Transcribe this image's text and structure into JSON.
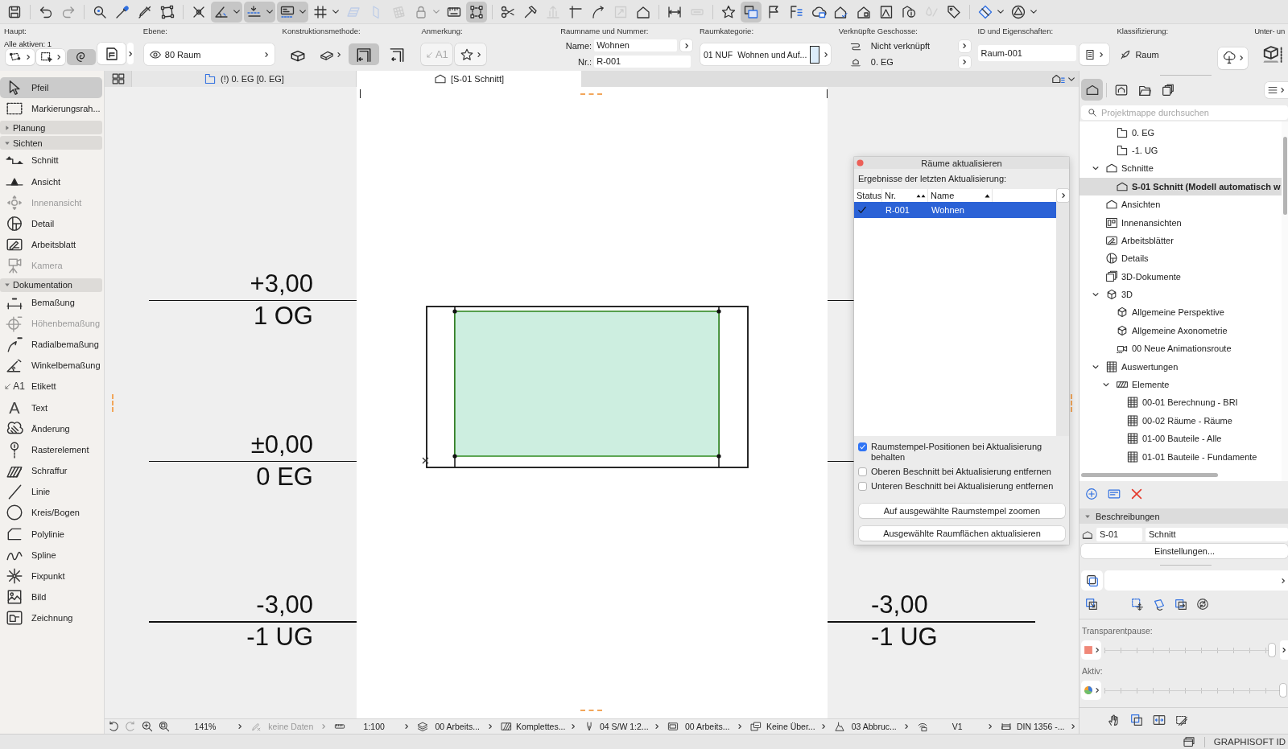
{
  "toolbar": {
    "groups": [
      [
        {
          "on": false,
          "disabled": false,
          "menu": false
        }
      ],
      [
        {
          "on": false,
          "disabled": false,
          "menu": false
        },
        {
          "on": false,
          "disabled": true,
          "menu": false
        }
      ],
      [
        {
          "on": false,
          "disabled": false,
          "menu": false
        },
        {
          "on": false,
          "disabled": false,
          "menu": false
        },
        {
          "on": false,
          "disabled": false,
          "menu": false
        },
        {
          "on": false,
          "disabled": false,
          "menu": false
        }
      ],
      [
        {
          "on": false,
          "disabled": false,
          "menu": false
        },
        {
          "on": true,
          "disabled": false,
          "menu": true
        },
        {
          "on": true,
          "disabled": false,
          "menu": true
        },
        {
          "on": true,
          "disabled": false,
          "menu": true
        },
        {
          "on": false,
          "disabled": false,
          "menu": true
        },
        {
          "on": false,
          "disabled": true,
          "menu": false
        },
        {
          "on": false,
          "disabled": true,
          "menu": false
        },
        {
          "on": false,
          "disabled": true,
          "menu": false
        },
        {
          "on": false,
          "disabled": true,
          "menu": true
        },
        {
          "on": false,
          "disabled": false,
          "menu": false
        },
        {
          "on": true,
          "disabled": false,
          "menu": false
        }
      ],
      [
        {
          "on": false,
          "disabled": false,
          "menu": false
        },
        {
          "on": false,
          "disabled": false,
          "menu": false
        },
        {
          "on": false,
          "disabled": true,
          "menu": false
        },
        {
          "on": false,
          "disabled": false,
          "menu": false
        },
        {
          "on": false,
          "disabled": false,
          "menu": false
        },
        {
          "on": false,
          "disabled": true,
          "menu": false
        },
        {
          "on": false,
          "disabled": false,
          "menu": false
        }
      ],
      [
        {
          "on": false,
          "disabled": false,
          "menu": false
        },
        {
          "on": false,
          "disabled": true,
          "menu": false
        }
      ],
      [
        {
          "on": false,
          "disabled": false,
          "menu": false
        },
        {
          "on": true,
          "disabled": false,
          "menu": false
        },
        {
          "on": false,
          "disabled": false,
          "menu": false
        },
        {
          "on": false,
          "disabled": false,
          "menu": false
        },
        {
          "on": false,
          "disabled": false,
          "menu": false
        },
        {
          "on": false,
          "disabled": false,
          "menu": false
        },
        {
          "on": false,
          "disabled": false,
          "menu": false
        },
        {
          "on": false,
          "disabled": false,
          "menu": false
        },
        {
          "on": false,
          "disabled": false,
          "menu": false
        },
        {
          "on": false,
          "disabled": true,
          "menu": false
        },
        {
          "on": false,
          "disabled": false,
          "menu": false
        }
      ],
      [
        {
          "on": false,
          "disabled": false,
          "menu": true
        },
        {
          "on": false,
          "disabled": false,
          "menu": true
        }
      ]
    ]
  },
  "info_box": {
    "main": {
      "title": "Haupt:",
      "status": "Alle aktiven: 1",
      "tools": [
        {
          "on": false,
          "menu": true
        },
        {
          "on": false,
          "menu": true
        },
        {
          "on": true,
          "menu": false
        }
      ]
    },
    "layer": {
      "title": "Ebene:",
      "value": "80 Raum"
    },
    "construction": {
      "title": "Konstruktionsmethode:",
      "methods": [
        {
          "selected": false,
          "menu": false
        },
        {
          "selected": false,
          "menu": true
        },
        {
          "selected": true,
          "menu": false
        },
        {
          "selected": false,
          "menu": false
        }
      ]
    },
    "annotation": {
      "title": "Anmerkung:",
      "tools": [
        {
          "label": "A1",
          "disabled": true,
          "menu": false
        },
        {
          "disabled": false,
          "menu": true
        }
      ]
    },
    "room_name": {
      "title": "Raumname und Nummer:",
      "fields": [
        {
          "label": "Name:",
          "value": "Wohnen"
        },
        {
          "label": "Nr.:",
          "value": "R-001"
        }
      ]
    },
    "category": {
      "title": "Raumkategorie:",
      "code": "01 NUF",
      "name": "Wohnen und Auf..."
    },
    "linked_stories": {
      "title": "Verknüpfte Geschosse:",
      "rows": [
        "Nicht verknüpft",
        "0. EG"
      ]
    },
    "properties": {
      "title": "ID und Eigenschaften:",
      "value": "Raum-001"
    },
    "classification": {
      "title": "Klassifizierung:",
      "value": "Raum"
    },
    "subelements": {
      "title": "Unter- un"
    }
  },
  "toolbox": {
    "tools": [
      {
        "label": "Pfeil",
        "selected": true,
        "disabled": false
      },
      {
        "label": "Markierungsrah...",
        "selected": false,
        "disabled": false
      }
    ],
    "groups": [
      {
        "label": "Planung",
        "expanded": false
      },
      {
        "label": "Sichten",
        "expanded": true,
        "tools": [
          {
            "label": "Schnitt",
            "selected": false,
            "disabled": false
          },
          {
            "label": "Ansicht",
            "selected": false,
            "disabled": false
          },
          {
            "label": "Innenansicht",
            "selected": false,
            "disabled": true
          },
          {
            "label": "Detail",
            "selected": false,
            "disabled": false
          },
          {
            "label": "Arbeitsblatt",
            "selected": false,
            "disabled": false
          },
          {
            "label": "Kamera",
            "selected": false,
            "disabled": true
          }
        ]
      },
      {
        "label": "Dokumentation",
        "expanded": true,
        "tools": [
          {
            "label": "Bemaßung",
            "selected": false,
            "disabled": false
          },
          {
            "label": "Höhenbemaßung",
            "selected": false,
            "disabled": true
          },
          {
            "label": "Radialbemaßung",
            "selected": false,
            "disabled": false
          },
          {
            "label": "Winkelbemaßung",
            "selected": false,
            "disabled": false
          },
          {
            "label": "Etikett",
            "glyph": "A1",
            "selected": false,
            "disabled": false
          },
          {
            "label": "Text",
            "glyph": "A",
            "selected": false,
            "disabled": false
          },
          {
            "label": "Änderung",
            "selected": false,
            "disabled": false
          },
          {
            "label": "Rasterelement",
            "selected": false,
            "disabled": false
          },
          {
            "label": "Schraffur",
            "selected": false,
            "disabled": false
          },
          {
            "label": "Linie",
            "selected": false,
            "disabled": false
          },
          {
            "label": "Kreis/Bogen",
            "selected": false,
            "disabled": false
          },
          {
            "label": "Polylinie",
            "selected": false,
            "disabled": false
          },
          {
            "label": "Spline",
            "selected": false,
            "disabled": false
          },
          {
            "label": "Fixpunkt",
            "selected": false,
            "disabled": false
          },
          {
            "label": "Bild",
            "selected": false,
            "disabled": false
          },
          {
            "label": "Zeichnung",
            "selected": false,
            "disabled": false
          }
        ]
      }
    ]
  },
  "view_tabs": [
    {
      "label": "(!) 0. EG [0. EG]",
      "kind": "plan",
      "selected": false
    },
    {
      "label": "[S-01 Schnitt]",
      "kind": "section",
      "selected": true
    }
  ],
  "canvas": {
    "levels": [
      {
        "left": {
          "elevation": "+3,00",
          "name": "1 OG"
        }
      },
      {
        "left": {
          "elevation": "±0,00",
          "name": "0 EG"
        }
      },
      {
        "left": {
          "elevation": "-3,00",
          "name": "-1 UG"
        },
        "right": {
          "elevation": "-3,00",
          "name": "-1 UG"
        }
      }
    ]
  },
  "update_dialog": {
    "title": "Räume aktualisieren",
    "subtitle": "Ergebnisse der letzten Aktualisierung:",
    "columns": [
      {
        "label": "Status",
        "kind": "plain"
      },
      {
        "label": "Nr.",
        "kind": "multisort"
      },
      {
        "label": "Name",
        "kind": "sorted"
      }
    ],
    "rows": [
      {
        "updated": true,
        "number": "R-001",
        "name": "Wohnen",
        "selected": true
      }
    ],
    "options": [
      {
        "label": "Raumstempel-Positionen bei Aktualisierung behalten",
        "checked": true
      },
      {
        "label": "Oberen Beschnitt bei Aktualisierung entfernen",
        "checked": false
      },
      {
        "label": "Unteren Beschnitt bei Aktualisierung entfernen",
        "checked": false
      }
    ],
    "buttons": [
      "Auf ausgewählte Raumstempel zoomen",
      "Ausgewählte Raumflächen aktualisieren"
    ]
  },
  "navigator": {
    "views": [
      {
        "selected": true
      },
      {
        "selected": false
      },
      {
        "selected": false
      },
      {
        "selected": false
      }
    ],
    "search": {
      "placeholder": "Projektmappe durchsuchen"
    },
    "tree": {
      "hidden_parent_children": [
        {
          "label": "0. EG",
          "kind": "story",
          "selected": false
        },
        {
          "label": "-1. UG",
          "kind": "story",
          "selected": false
        }
      ],
      "items": [
        {
          "label": "Schnitte",
          "kind": "section",
          "selected": false,
          "expanded": true,
          "children": [
            {
              "label": "S-01 Schnitt (Modell automatisch w",
              "kind": "section",
              "selected": true
            }
          ]
        },
        {
          "label": "Ansichten",
          "kind": "elevation",
          "selected": false
        },
        {
          "label": "Innenansichten",
          "kind": "interior",
          "selected": false
        },
        {
          "label": "Arbeitsblätter",
          "kind": "worksheet",
          "selected": false
        },
        {
          "label": "Details",
          "kind": "detail",
          "selected": false
        },
        {
          "label": "3D-Dokumente",
          "kind": "document",
          "selected": false
        },
        {
          "label": "3D",
          "kind": "model",
          "selected": false,
          "expanded": true,
          "children": [
            {
              "label": "Allgemeine Perspektive",
              "kind": "perspective",
              "selected": false
            },
            {
              "label": "Allgemeine Axonometrie",
              "kind": "axonometry",
              "selected": false
            },
            {
              "label": "00 Neue Animationsroute",
              "kind": "route",
              "selected": false
            }
          ]
        },
        {
          "label": "Auswertungen",
          "kind": "schedule",
          "selected": false,
          "expanded": true,
          "children": [
            {
              "label": "Elemente",
              "kind": "category",
              "selected": false,
              "expanded": true,
              "children": [
                {
                  "label": "00-01 Berechnung - BRI",
                  "kind": "schedule",
                  "selected": false
                },
                {
                  "label": "00-02 Räume - Räume",
                  "kind": "schedule",
                  "selected": false
                },
                {
                  "label": "01-00 Bauteile - Alle",
                  "kind": "schedule",
                  "selected": false
                },
                {
                  "label": "01-01 Bauteile - Fundamente",
                  "kind": "schedule",
                  "selected": false
                }
              ]
            }
          ]
        }
      ]
    },
    "descriptions": {
      "title": "Beschreibungen",
      "expanded": true,
      "id": "S-01",
      "name": "Schnitt"
    },
    "settings_button": "Einstellungen...",
    "sliders": [
      {
        "label": "Transparentpause:",
        "level": 1
      },
      {
        "label": "Aktiv:",
        "level": 1
      }
    ]
  },
  "status_bar": {
    "view_buttons": [
      {
        "disabled": false
      },
      {
        "disabled": true
      },
      {
        "disabled": false
      },
      {
        "disabled": false
      }
    ],
    "zoom": "141%",
    "items": [
      {
        "label": "keine Daten",
        "disabled": true
      },
      {
        "label": "1:100",
        "disabled": false
      },
      {
        "label": "00 Arbeits...",
        "disabled": false
      },
      {
        "label": "Komplettes...",
        "disabled": false
      },
      {
        "label": "04 S/W 1:2...",
        "disabled": false
      },
      {
        "label": "00 Arbeits...",
        "disabled": false
      },
      {
        "label": "Keine Über...",
        "disabled": false
      },
      {
        "label": "03 Abbruc...",
        "disabled": false
      },
      {
        "label": "V1",
        "disabled": false
      },
      {
        "label": "DIN 1356 -...",
        "disabled": false
      }
    ]
  },
  "footer": {
    "brand": "GRAPHISOFT ID"
  }
}
